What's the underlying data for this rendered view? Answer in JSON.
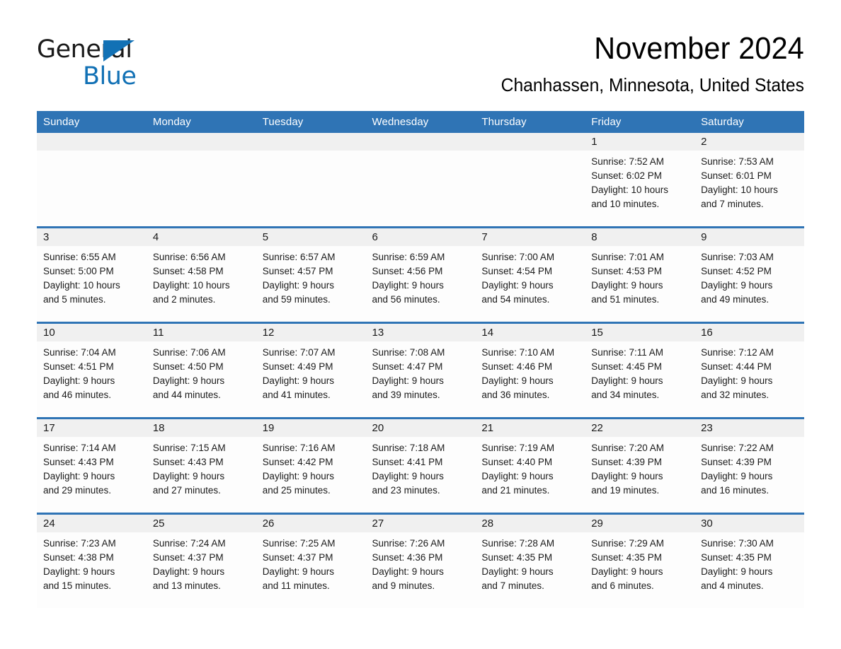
{
  "logo": {
    "word_one": "General",
    "word_two": "Blue",
    "triangle_color": "#1271b5",
    "text_color": "#1a1a1a"
  },
  "header": {
    "month_title": "November 2024",
    "location": "Chanhassen, Minnesota, United States"
  },
  "colors": {
    "header_blue": "#2f74b5",
    "row_separator_blue": "#2f74b5",
    "daynum_band": "#f0f0f0",
    "cell_background": "#fdfdfd",
    "page_background": "#ffffff"
  },
  "calendar": {
    "weekday_headers": [
      "Sunday",
      "Monday",
      "Tuesday",
      "Wednesday",
      "Thursday",
      "Friday",
      "Saturday"
    ],
    "weeks": [
      [
        {
          "empty": true
        },
        {
          "empty": true
        },
        {
          "empty": true
        },
        {
          "empty": true
        },
        {
          "empty": true
        },
        {
          "day": "1",
          "sunrise": "Sunrise: 7:52 AM",
          "sunset": "Sunset: 6:02 PM",
          "daylight_line1": "Daylight: 10 hours",
          "daylight_line2": "and 10 minutes."
        },
        {
          "day": "2",
          "sunrise": "Sunrise: 7:53 AM",
          "sunset": "Sunset: 6:01 PM",
          "daylight_line1": "Daylight: 10 hours",
          "daylight_line2": "and 7 minutes."
        }
      ],
      [
        {
          "day": "3",
          "sunrise": "Sunrise: 6:55 AM",
          "sunset": "Sunset: 5:00 PM",
          "daylight_line1": "Daylight: 10 hours",
          "daylight_line2": "and 5 minutes."
        },
        {
          "day": "4",
          "sunrise": "Sunrise: 6:56 AM",
          "sunset": "Sunset: 4:58 PM",
          "daylight_line1": "Daylight: 10 hours",
          "daylight_line2": "and 2 minutes."
        },
        {
          "day": "5",
          "sunrise": "Sunrise: 6:57 AM",
          "sunset": "Sunset: 4:57 PM",
          "daylight_line1": "Daylight: 9 hours",
          "daylight_line2": "and 59 minutes."
        },
        {
          "day": "6",
          "sunrise": "Sunrise: 6:59 AM",
          "sunset": "Sunset: 4:56 PM",
          "daylight_line1": "Daylight: 9 hours",
          "daylight_line2": "and 56 minutes."
        },
        {
          "day": "7",
          "sunrise": "Sunrise: 7:00 AM",
          "sunset": "Sunset: 4:54 PM",
          "daylight_line1": "Daylight: 9 hours",
          "daylight_line2": "and 54 minutes."
        },
        {
          "day": "8",
          "sunrise": "Sunrise: 7:01 AM",
          "sunset": "Sunset: 4:53 PM",
          "daylight_line1": "Daylight: 9 hours",
          "daylight_line2": "and 51 minutes."
        },
        {
          "day": "9",
          "sunrise": "Sunrise: 7:03 AM",
          "sunset": "Sunset: 4:52 PM",
          "daylight_line1": "Daylight: 9 hours",
          "daylight_line2": "and 49 minutes."
        }
      ],
      [
        {
          "day": "10",
          "sunrise": "Sunrise: 7:04 AM",
          "sunset": "Sunset: 4:51 PM",
          "daylight_line1": "Daylight: 9 hours",
          "daylight_line2": "and 46 minutes."
        },
        {
          "day": "11",
          "sunrise": "Sunrise: 7:06 AM",
          "sunset": "Sunset: 4:50 PM",
          "daylight_line1": "Daylight: 9 hours",
          "daylight_line2": "and 44 minutes."
        },
        {
          "day": "12",
          "sunrise": "Sunrise: 7:07 AM",
          "sunset": "Sunset: 4:49 PM",
          "daylight_line1": "Daylight: 9 hours",
          "daylight_line2": "and 41 minutes."
        },
        {
          "day": "13",
          "sunrise": "Sunrise: 7:08 AM",
          "sunset": "Sunset: 4:47 PM",
          "daylight_line1": "Daylight: 9 hours",
          "daylight_line2": "and 39 minutes."
        },
        {
          "day": "14",
          "sunrise": "Sunrise: 7:10 AM",
          "sunset": "Sunset: 4:46 PM",
          "daylight_line1": "Daylight: 9 hours",
          "daylight_line2": "and 36 minutes."
        },
        {
          "day": "15",
          "sunrise": "Sunrise: 7:11 AM",
          "sunset": "Sunset: 4:45 PM",
          "daylight_line1": "Daylight: 9 hours",
          "daylight_line2": "and 34 minutes."
        },
        {
          "day": "16",
          "sunrise": "Sunrise: 7:12 AM",
          "sunset": "Sunset: 4:44 PM",
          "daylight_line1": "Daylight: 9 hours",
          "daylight_line2": "and 32 minutes."
        }
      ],
      [
        {
          "day": "17",
          "sunrise": "Sunrise: 7:14 AM",
          "sunset": "Sunset: 4:43 PM",
          "daylight_line1": "Daylight: 9 hours",
          "daylight_line2": "and 29 minutes."
        },
        {
          "day": "18",
          "sunrise": "Sunrise: 7:15 AM",
          "sunset": "Sunset: 4:43 PM",
          "daylight_line1": "Daylight: 9 hours",
          "daylight_line2": "and 27 minutes."
        },
        {
          "day": "19",
          "sunrise": "Sunrise: 7:16 AM",
          "sunset": "Sunset: 4:42 PM",
          "daylight_line1": "Daylight: 9 hours",
          "daylight_line2": "and 25 minutes."
        },
        {
          "day": "20",
          "sunrise": "Sunrise: 7:18 AM",
          "sunset": "Sunset: 4:41 PM",
          "daylight_line1": "Daylight: 9 hours",
          "daylight_line2": "and 23 minutes."
        },
        {
          "day": "21",
          "sunrise": "Sunrise: 7:19 AM",
          "sunset": "Sunset: 4:40 PM",
          "daylight_line1": "Daylight: 9 hours",
          "daylight_line2": "and 21 minutes."
        },
        {
          "day": "22",
          "sunrise": "Sunrise: 7:20 AM",
          "sunset": "Sunset: 4:39 PM",
          "daylight_line1": "Daylight: 9 hours",
          "daylight_line2": "and 19 minutes."
        },
        {
          "day": "23",
          "sunrise": "Sunrise: 7:22 AM",
          "sunset": "Sunset: 4:39 PM",
          "daylight_line1": "Daylight: 9 hours",
          "daylight_line2": "and 16 minutes."
        }
      ],
      [
        {
          "day": "24",
          "sunrise": "Sunrise: 7:23 AM",
          "sunset": "Sunset: 4:38 PM",
          "daylight_line1": "Daylight: 9 hours",
          "daylight_line2": "and 15 minutes."
        },
        {
          "day": "25",
          "sunrise": "Sunrise: 7:24 AM",
          "sunset": "Sunset: 4:37 PM",
          "daylight_line1": "Daylight: 9 hours",
          "daylight_line2": "and 13 minutes."
        },
        {
          "day": "26",
          "sunrise": "Sunrise: 7:25 AM",
          "sunset": "Sunset: 4:37 PM",
          "daylight_line1": "Daylight: 9 hours",
          "daylight_line2": "and 11 minutes."
        },
        {
          "day": "27",
          "sunrise": "Sunrise: 7:26 AM",
          "sunset": "Sunset: 4:36 PM",
          "daylight_line1": "Daylight: 9 hours",
          "daylight_line2": "and 9 minutes."
        },
        {
          "day": "28",
          "sunrise": "Sunrise: 7:28 AM",
          "sunset": "Sunset: 4:35 PM",
          "daylight_line1": "Daylight: 9 hours",
          "daylight_line2": "and 7 minutes."
        },
        {
          "day": "29",
          "sunrise": "Sunrise: 7:29 AM",
          "sunset": "Sunset: 4:35 PM",
          "daylight_line1": "Daylight: 9 hours",
          "daylight_line2": "and 6 minutes."
        },
        {
          "day": "30",
          "sunrise": "Sunrise: 7:30 AM",
          "sunset": "Sunset: 4:35 PM",
          "daylight_line1": "Daylight: 9 hours",
          "daylight_line2": "and 4 minutes."
        }
      ]
    ]
  }
}
